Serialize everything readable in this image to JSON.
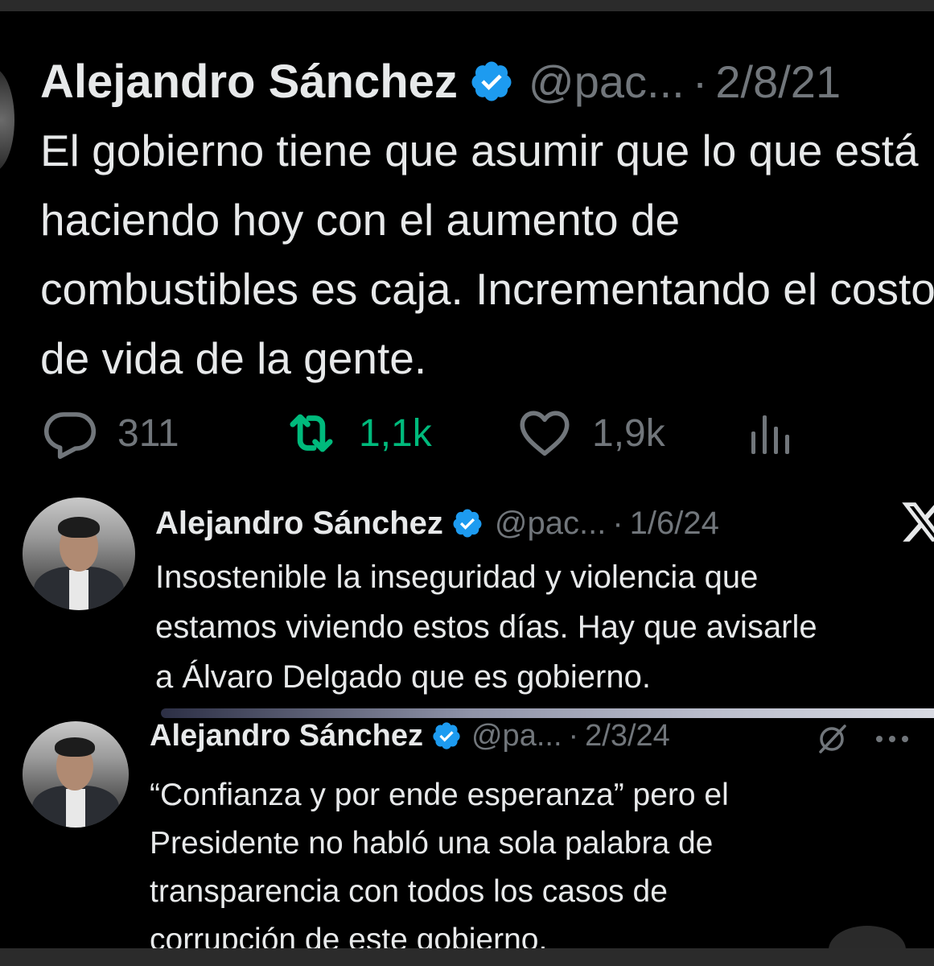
{
  "tweets": [
    {
      "name": "Alejandro Sánchez",
      "handle": "@pac...",
      "separator": "·",
      "date": "2/8/21",
      "lines": [
        "El gobierno tiene que asumir que lo que está",
        "haciendo hoy con el aumento de",
        "combustibles es caja. Incrementando el costo",
        "de vida de la gente."
      ],
      "metrics": {
        "replies": "311",
        "retweets": "1,1k",
        "likes": "1,9k"
      }
    },
    {
      "name": "Alejandro Sánchez",
      "handle": "@pac...",
      "separator": "·",
      "date": "1/6/24",
      "lines": [
        "Insostenible la inseguridad y violencia que",
        "estamos viviendo estos días. Hay que avisarle",
        "a Álvaro Delgado que es gobierno."
      ]
    },
    {
      "name": "Alejandro Sánchez",
      "handle": "@pa...",
      "separator": "·",
      "date": "2/3/24",
      "lines": [
        "“Confianza y por ende esperanza” pero el",
        "Presidente no habló una sola palabra de",
        "transparencia con todos los casos de",
        "corrupción de este gobierno."
      ]
    }
  ],
  "icons": {
    "verified": "verified-badge-icon",
    "reply": "reply-icon",
    "retweet": "retweet-icon",
    "like": "heart-icon",
    "views": "views-icon",
    "x_logo": "x-logo-icon",
    "grok": "grok-icon",
    "more": "more-icon"
  },
  "colors": {
    "background": "#000000",
    "text": "#e7e9ea",
    "muted": "#71767b",
    "verified": "#1d9bf0",
    "retweet": "#00ba7c"
  }
}
